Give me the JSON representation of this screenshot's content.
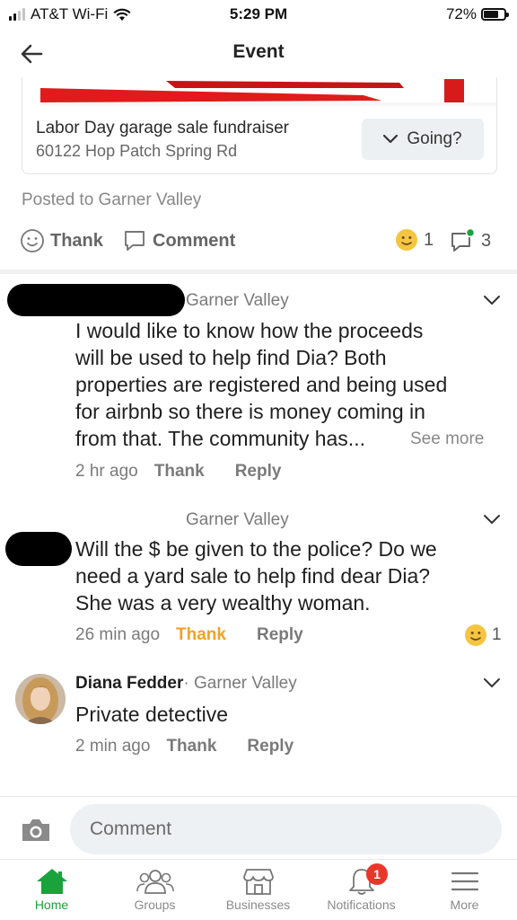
{
  "status_bar": {
    "carrier": "AT&T Wi-Fi",
    "time": "5:29 PM",
    "battery": "72%"
  },
  "nav": {
    "title": "Event"
  },
  "event": {
    "title": "Labor Day garage sale fundraiser",
    "address": "60122 Hop Patch Spring Rd",
    "going_label": "Going?"
  },
  "post": {
    "posted_to": "Posted to Garner Valley",
    "thank_label": "Thank",
    "comment_label": "Comment",
    "thank_count": "1",
    "comment_count": "3"
  },
  "comments": [
    {
      "group": "Garner Valley",
      "text_lines": [
        "I would like to know how the proceeds",
        "will be used to help find Dia? Both",
        "properties are registered and being used",
        "for airbnb so there is money coming in",
        "from that. The community has..."
      ],
      "see_more": "See more",
      "time": "2 hr ago",
      "thank": "Thank",
      "reply": "Reply"
    },
    {
      "group": "Garner Valley",
      "text_lines": [
        "Will the $ be given to the police?  Do we",
        "need a yard sale to help find dear Dia?",
        "She was a very wealthy woman."
      ],
      "time": "26 min ago",
      "thank": "Thank",
      "reply": "Reply",
      "thank_count": "1"
    },
    {
      "name": "Diana Fedder",
      "group": "· Garner Valley",
      "text": "Private detective",
      "time": "2 min ago",
      "thank": "Thank",
      "reply": "Reply"
    }
  ],
  "composer": {
    "placeholder": "Comment"
  },
  "tabs": [
    {
      "label": "Home"
    },
    {
      "label": "Groups"
    },
    {
      "label": "Businesses"
    },
    {
      "label": "Notifications",
      "badge": "1"
    },
    {
      "label": "More"
    }
  ],
  "colors": {
    "brand_green": "#1aa33c",
    "thank_active": "#f0a22b",
    "badge_red": "#e8372a",
    "emoji_yellow": "#f5c542"
  }
}
